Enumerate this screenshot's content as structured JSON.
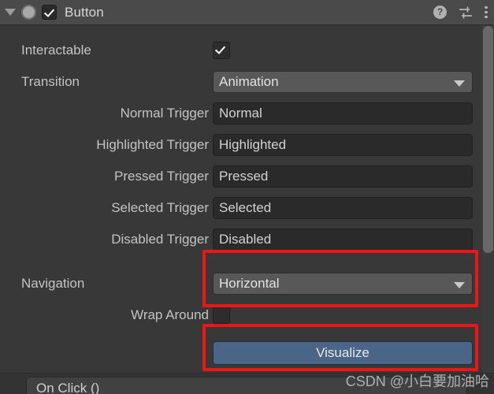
{
  "header": {
    "title": "Button",
    "foldout_icon": "triangle-down-icon",
    "component_icon": "button-component-icon",
    "enabled_checkbox": true,
    "help_icon": "?",
    "preset_icon": "preset-sliders-icon",
    "menu_icon": "kebab-menu-icon"
  },
  "rows": {
    "interactable": {
      "label": "Interactable",
      "checked": true
    },
    "transition": {
      "label": "Transition",
      "value": "Animation"
    },
    "normal_trigger": {
      "label": "Normal Trigger",
      "value": "Normal"
    },
    "highlighted_trigger": {
      "label": "Highlighted Trigger",
      "value": "Highlighted"
    },
    "pressed_trigger": {
      "label": "Pressed Trigger",
      "value": "Pressed"
    },
    "selected_trigger": {
      "label": "Selected Trigger",
      "value": "Selected"
    },
    "disabled_trigger": {
      "label": "Disabled Trigger",
      "value": "Disabled"
    },
    "navigation": {
      "label": "Navigation",
      "value": "Horizontal"
    },
    "wrap_around": {
      "label": "Wrap Around",
      "checked": false
    },
    "visualize": {
      "label": "Visualize"
    }
  },
  "onclick": {
    "label": "On Click ()"
  },
  "watermark": {
    "text": "CSDN @小白要加油哈"
  },
  "colors": {
    "panel_bg": "#383838",
    "header_bg": "#4a4a4a",
    "field_bg": "#2a2a2a",
    "dropdown_bg": "#585858",
    "visualize_blue": "#4a6586",
    "annotation_red": "#f01515",
    "text": "#c3c3c3"
  }
}
